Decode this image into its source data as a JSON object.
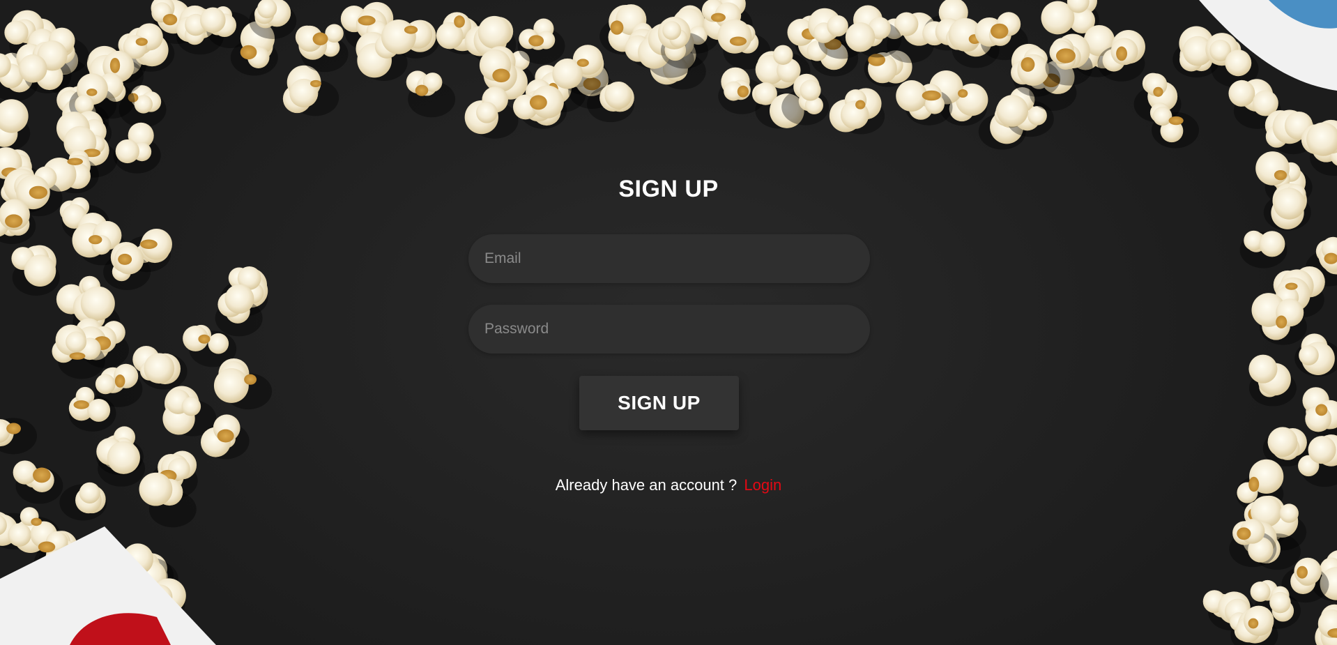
{
  "signup": {
    "title": "SIGN UP",
    "email_placeholder": "Email",
    "password_placeholder": "Password",
    "button_label": "SIGN UP",
    "footer_text": "Already have an account ?",
    "login_link": "Login"
  },
  "colors": {
    "background": "#1e1e1e",
    "field_bg": "#2f2f2f",
    "button_bg": "#333333",
    "link": "#e50914",
    "text": "#ffffff"
  }
}
